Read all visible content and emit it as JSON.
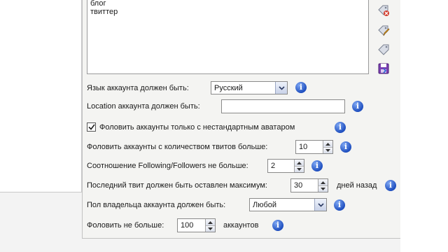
{
  "textarea": {
    "lines": [
      "блог",
      "твиттер"
    ]
  },
  "side_icons": [
    "tag-remove-icon",
    "tag-edit-icon",
    "tag-icon",
    "save-icon"
  ],
  "form": {
    "language": {
      "label": "Язык аккаунта должен быть:",
      "value": "Русский"
    },
    "location": {
      "label": "Location аккаунта должен быть:",
      "value": ""
    },
    "avatar": {
      "label": "Фоловить аккаунты только с нестандартным аватаром",
      "checked": true
    },
    "tweets": {
      "label": "Фоловить аккаунты с количеством твитов больше:",
      "value": "10"
    },
    "ratio": {
      "label": "Соотношение Following/Followers не больше:",
      "value": "2"
    },
    "last_tweet": {
      "label": "Последний твит должен быть оставлен максимум:",
      "value": "30",
      "suffix": "дней назад"
    },
    "gender": {
      "label": "Пол владельца аккаунта должен быть:",
      "value": "Любой"
    },
    "max_follow": {
      "label": "Фоловить не больше:",
      "value": "100",
      "suffix": "аккаунтов"
    }
  },
  "info_glyph": "i",
  "colors": {
    "info": "#1f4fbf",
    "border": "#8a8a8a"
  }
}
